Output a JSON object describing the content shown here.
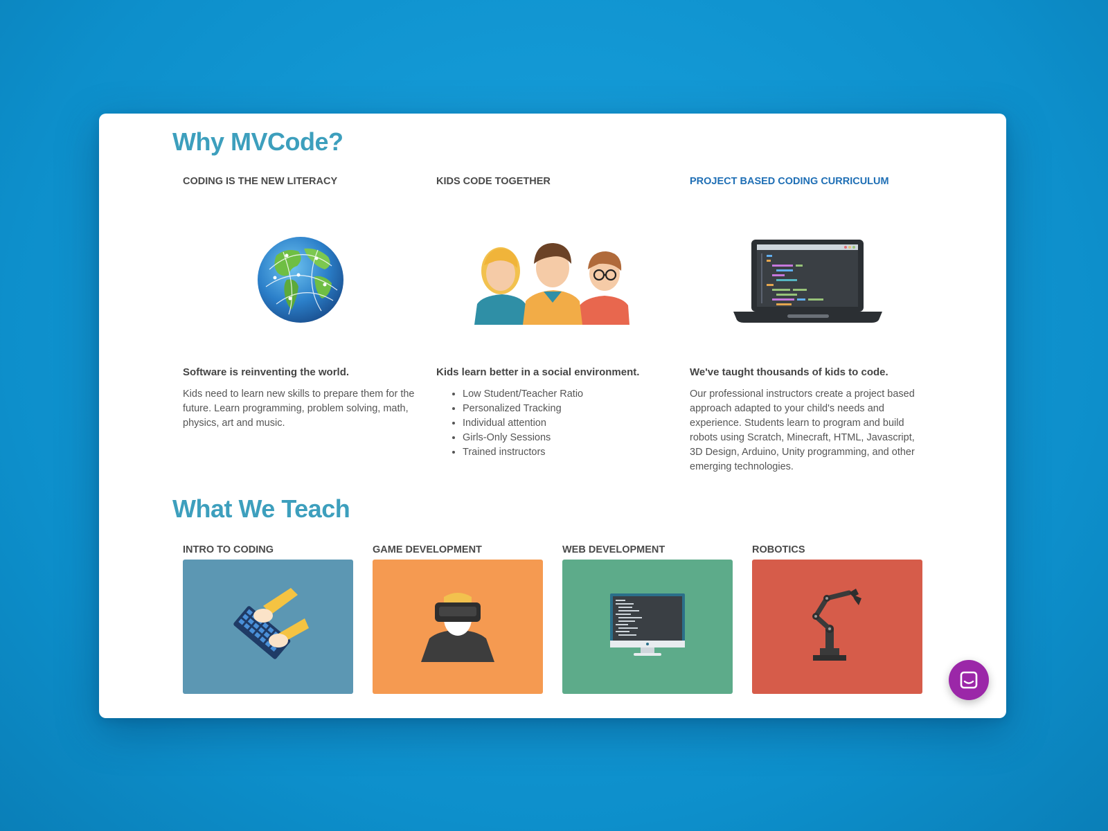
{
  "why_section": {
    "title": "Why MVCode?",
    "features": [
      {
        "heading": "CODING IS THE NEW LITERACY",
        "icon": "globe-icon",
        "subtitle": "Software is reinventing the world.",
        "body": "Kids need to learn new skills to prepare them for the future. Learn programming, problem solving, math, physics, art and music."
      },
      {
        "heading": "KIDS CODE TOGETHER",
        "icon": "kids-group-icon",
        "subtitle": "Kids learn better in a social environment.",
        "bullets": [
          "Low Student/Teacher Ratio",
          "Personalized Tracking",
          "Individual attention",
          "Girls-Only Sessions",
          "Trained instructors"
        ]
      },
      {
        "heading": "PROJECT BASED CODING CURRICULUM",
        "icon": "laptop-code-icon",
        "subtitle": "We've taught thousands of kids to code.",
        "body": "Our professional instructors create a project based approach adapted to your child's needs and experience. Students learn to program and build robots using Scratch, Minecraft, HTML, Javascript, 3D Design, Arduino, Unity programming, and other emerging technologies."
      }
    ]
  },
  "teach_section": {
    "title": "What We Teach",
    "courses": [
      {
        "label": "INTRO TO CODING",
        "icon": "keyboard-hands-icon",
        "color": "#5c97b3"
      },
      {
        "label": "GAME DEVELOPMENT",
        "icon": "vr-headset-icon",
        "color": "#f59a51"
      },
      {
        "label": "WEB DEVELOPMENT",
        "icon": "monitor-code-icon",
        "color": "#5dab8a"
      },
      {
        "label": "ROBOTICS",
        "icon": "robot-arm-icon",
        "color": "#d65c4a"
      }
    ]
  },
  "chat": {
    "icon": "chat-icon",
    "color": "#9b27a8"
  },
  "colors": {
    "title": "#3d9fbd",
    "link": "#1f6fb5",
    "background": "#1199d4"
  }
}
